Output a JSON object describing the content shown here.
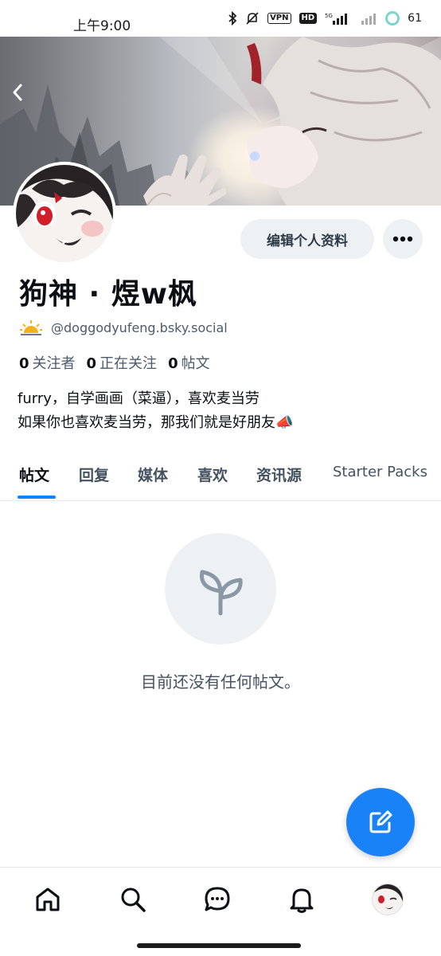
{
  "status_bar": {
    "time": "上午9:00",
    "vpn": "VPN",
    "hd": "HD",
    "battery": "61"
  },
  "profile": {
    "display_name": "狗神 · 煜w枫",
    "handle": "@doggodyufeng.bsky.social",
    "edit_profile_label": "编辑个人资料",
    "followers_count": "0",
    "followers_label": "关注者",
    "following_count": "0",
    "following_label": "正在关注",
    "posts_count": "0",
    "posts_label": "帖文",
    "bio_line1": "furry，自学画画（菜逼），喜欢麦当劳",
    "bio_line2": "如果你也喜欢麦当劳，那我们就是好朋友📣"
  },
  "tabs": [
    {
      "label": "帖文",
      "active": true
    },
    {
      "label": "回复",
      "active": false
    },
    {
      "label": "媒体",
      "active": false
    },
    {
      "label": "喜欢",
      "active": false
    },
    {
      "label": "资讯源",
      "active": false
    },
    {
      "label": "Starter Packs",
      "active": false
    }
  ],
  "empty_state": {
    "message": "目前还没有任何帖文。",
    "icon": "sprout-icon"
  },
  "bottom_nav": {
    "items": [
      "home-icon",
      "search-icon",
      "chat-icon",
      "bell-icon",
      "avatar"
    ]
  },
  "colors": {
    "accent": "#1083fe",
    "fab": "#1a82f7",
    "button_bg": "#eef1f4",
    "muted_text": "#44525f"
  }
}
